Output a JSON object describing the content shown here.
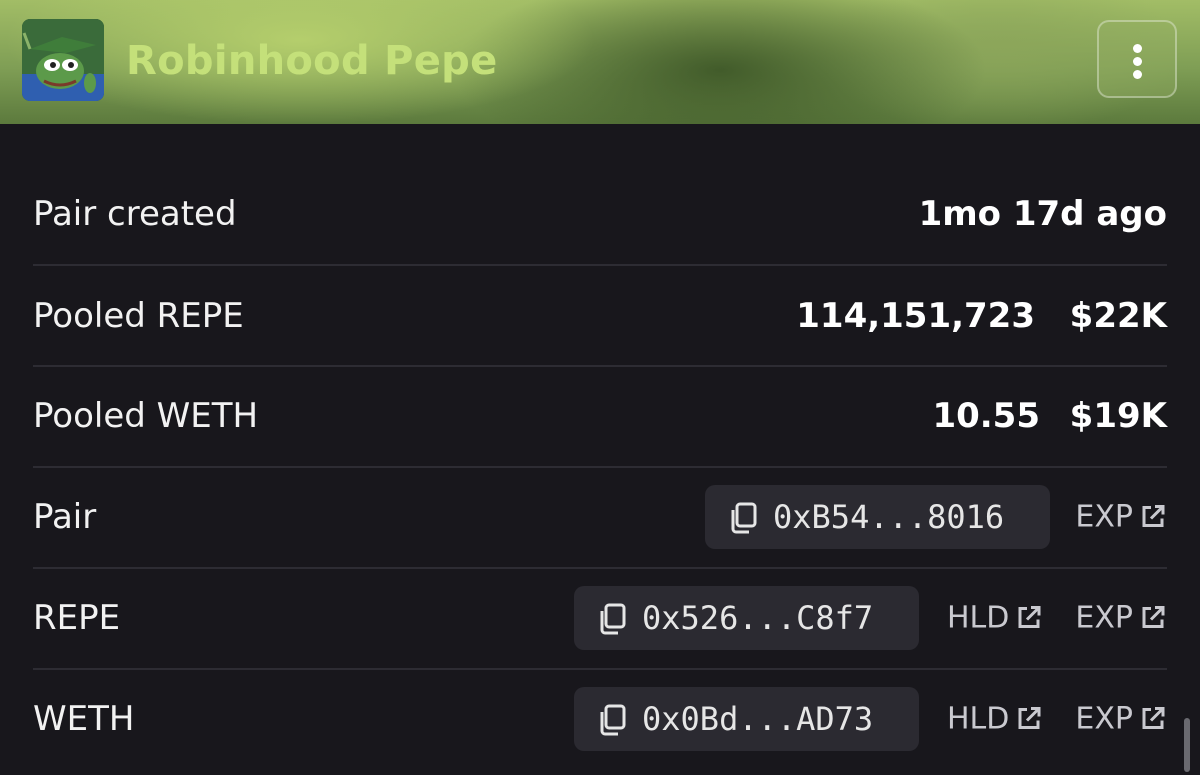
{
  "header": {
    "token_name": "Robinhood Pepe",
    "avatar_icon": "pepe-robinhood-avatar",
    "menu_icon": "kebab-menu-icon"
  },
  "rows": {
    "pair_created": {
      "label": "Pair created",
      "value": "1mo 17d ago"
    },
    "pooled_repe": {
      "label": "Pooled REPE",
      "amount": "114,151,723",
      "usd": "$22K"
    },
    "pooled_weth": {
      "label": "Pooled WETH",
      "amount": "10.55",
      "usd": "$19K"
    },
    "pair": {
      "label": "Pair",
      "address": "0xB54...8016",
      "exp_label": "EXP"
    },
    "repe": {
      "label": "REPE",
      "address": "0x526...C8f7",
      "hld_label": "HLD",
      "exp_label": "EXP"
    },
    "weth": {
      "label": "WETH",
      "address": "0x0Bd...AD73",
      "hld_label": "HLD",
      "exp_label": "EXP"
    }
  },
  "colors": {
    "background": "#18171c",
    "chip": "#2b2a31",
    "token_name": "#c4e07a",
    "divider": "#2d2c33"
  }
}
